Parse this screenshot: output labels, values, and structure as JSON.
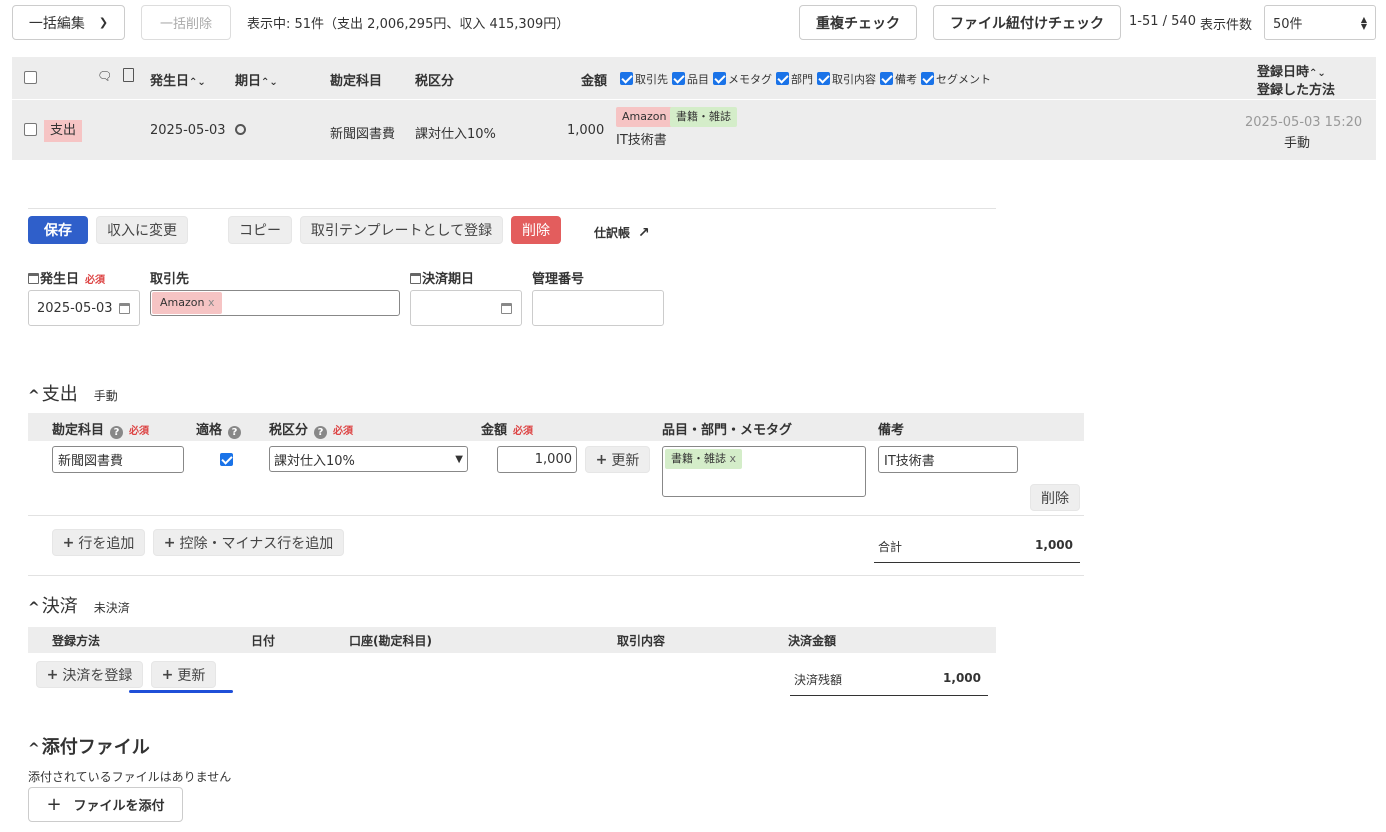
{
  "toolbar": {
    "bulk_edit": "一括編集",
    "bulk_delete": "一括削除",
    "summary": "表示中: 51件（支出 2,006,295円、収入 415,309円）",
    "dup_check": "重複チェック",
    "file_link_check": "ファイル紐付けチェック",
    "pagination": "1-51 / 540",
    "page_size_label": "表示件数",
    "page_size_value": "50件"
  },
  "table_header": {
    "issue_date": "発生日",
    "due_date": "期日",
    "account": "勘定科目",
    "tax": "税区分",
    "amount": "金額",
    "toggles": [
      "取引先",
      "品目",
      "メモタグ",
      "部門",
      "取引内容",
      "備考",
      "セグメント"
    ],
    "registered_at": "登録日時",
    "registered_method": "登録した方法"
  },
  "row": {
    "type_badge": "支出",
    "date": "2025-05-03",
    "account": "新聞図書費",
    "tax": "課対仕入10%",
    "amount": "1,000",
    "partner_tag": "Amazon",
    "item_tag": "書籍・雑誌",
    "memo": "IT技術書",
    "registered_at": "2025-05-03 15:20",
    "method": "手動"
  },
  "actions": {
    "save": "保存",
    "change_to_income": "収入に変更",
    "copy": "コピー",
    "register_template": "取引テンプレートとして登録",
    "delete": "削除",
    "journal": "仕訳帳"
  },
  "form": {
    "issue_date_label": "発生日",
    "required": "必須",
    "issue_date_value": "2025-05-03",
    "partner_label": "取引先",
    "partner_value": "Amazon",
    "due_date_label": "決済期日",
    "control_no_label": "管理番号"
  },
  "expense": {
    "title": "支出",
    "subtitle": "手動",
    "col_account": "勘定科目",
    "col_eligible": "適格",
    "col_tax": "税区分",
    "col_amount": "金額",
    "col_tags": "品目・部門・メモタグ",
    "col_note": "備考",
    "account_value": "新聞図書費",
    "tax_value": "課対仕入10%",
    "amount_value": "1,000",
    "update": "更新",
    "tag_value": "書籍・雑誌",
    "note_value": "IT技術書",
    "delete": "削除",
    "add_row": "行を追加",
    "add_minus_row": "控除・マイナス行を追加",
    "total_label": "合計",
    "total_value": "1,000"
  },
  "settlement": {
    "title": "決済",
    "subtitle": "未決済",
    "col_method": "登録方法",
    "col_date": "日付",
    "col_account": "口座(勘定科目)",
    "col_content": "取引内容",
    "col_amount": "決済金額",
    "register": "決済を登録",
    "update": "更新",
    "balance_label": "決済残額",
    "balance_value": "1,000"
  },
  "attachment": {
    "title": "添付ファイル",
    "empty": "添付されているファイルはありません",
    "add": "ファイルを添付"
  },
  "colors": {
    "primary": "#2f5fca",
    "danger": "#e35d5d",
    "tag_red": "#f6c4c4",
    "tag_green": "#d4edc9",
    "focus_underline": "#1f4fd8"
  }
}
